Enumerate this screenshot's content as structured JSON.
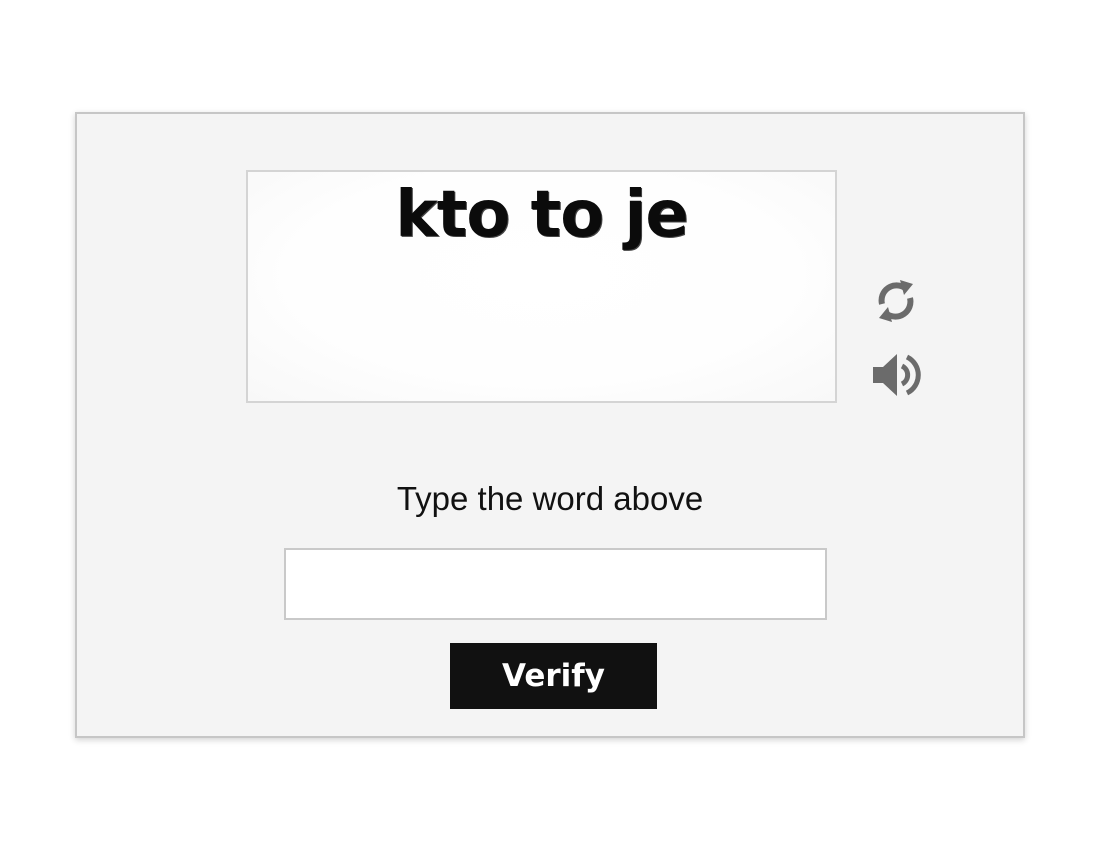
{
  "captcha": {
    "word": "kto to je",
    "refresh_icon": "refresh-icon",
    "audio_icon": "speaker-icon"
  },
  "form": {
    "prompt": "Type the word above",
    "answer_value": "",
    "answer_placeholder": "",
    "verify_label": "Verify"
  },
  "colors": {
    "panel_background": "#f4f4f4",
    "button_background": "#111111",
    "button_text": "#ffffff",
    "icon_gray": "#6b6b6b"
  }
}
